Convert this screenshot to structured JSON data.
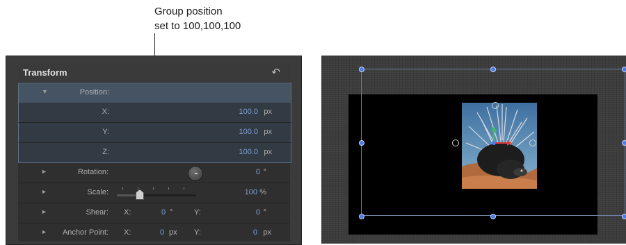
{
  "callout": {
    "line1": "Group position",
    "line2": "set to 100,100,100"
  },
  "inspector": {
    "title": "Transform",
    "reset_icon": "reset-arrow-icon",
    "position": {
      "label": "Position:",
      "x_label": "X:",
      "x_value": "100.0",
      "x_unit": "px",
      "y_label": "Y:",
      "y_value": "100.0",
      "y_unit": "px",
      "z_label": "Z:",
      "z_value": "100.0",
      "z_unit": "px"
    },
    "rotation": {
      "label": "Rotation:",
      "value": "0",
      "unit": "°"
    },
    "scale": {
      "label": "Scale:",
      "value": "100",
      "unit": "%",
      "slider_fraction": 0.28
    },
    "shear": {
      "label": "Shear:",
      "x_label": "X:",
      "x_value": "0",
      "x_unit": "°",
      "y_label": "Y:",
      "y_value": "0",
      "y_unit": "°"
    },
    "anchor": {
      "label": "Anchor Point:",
      "x_label": "X:",
      "x_value": "0",
      "x_unit": "px",
      "y_label": "Y:",
      "y_value": "0",
      "y_unit": "px"
    }
  },
  "colors": {
    "value_blue": "#7f9fcf",
    "selection_row": "#465363",
    "handle_blue": "#4a7be6"
  }
}
